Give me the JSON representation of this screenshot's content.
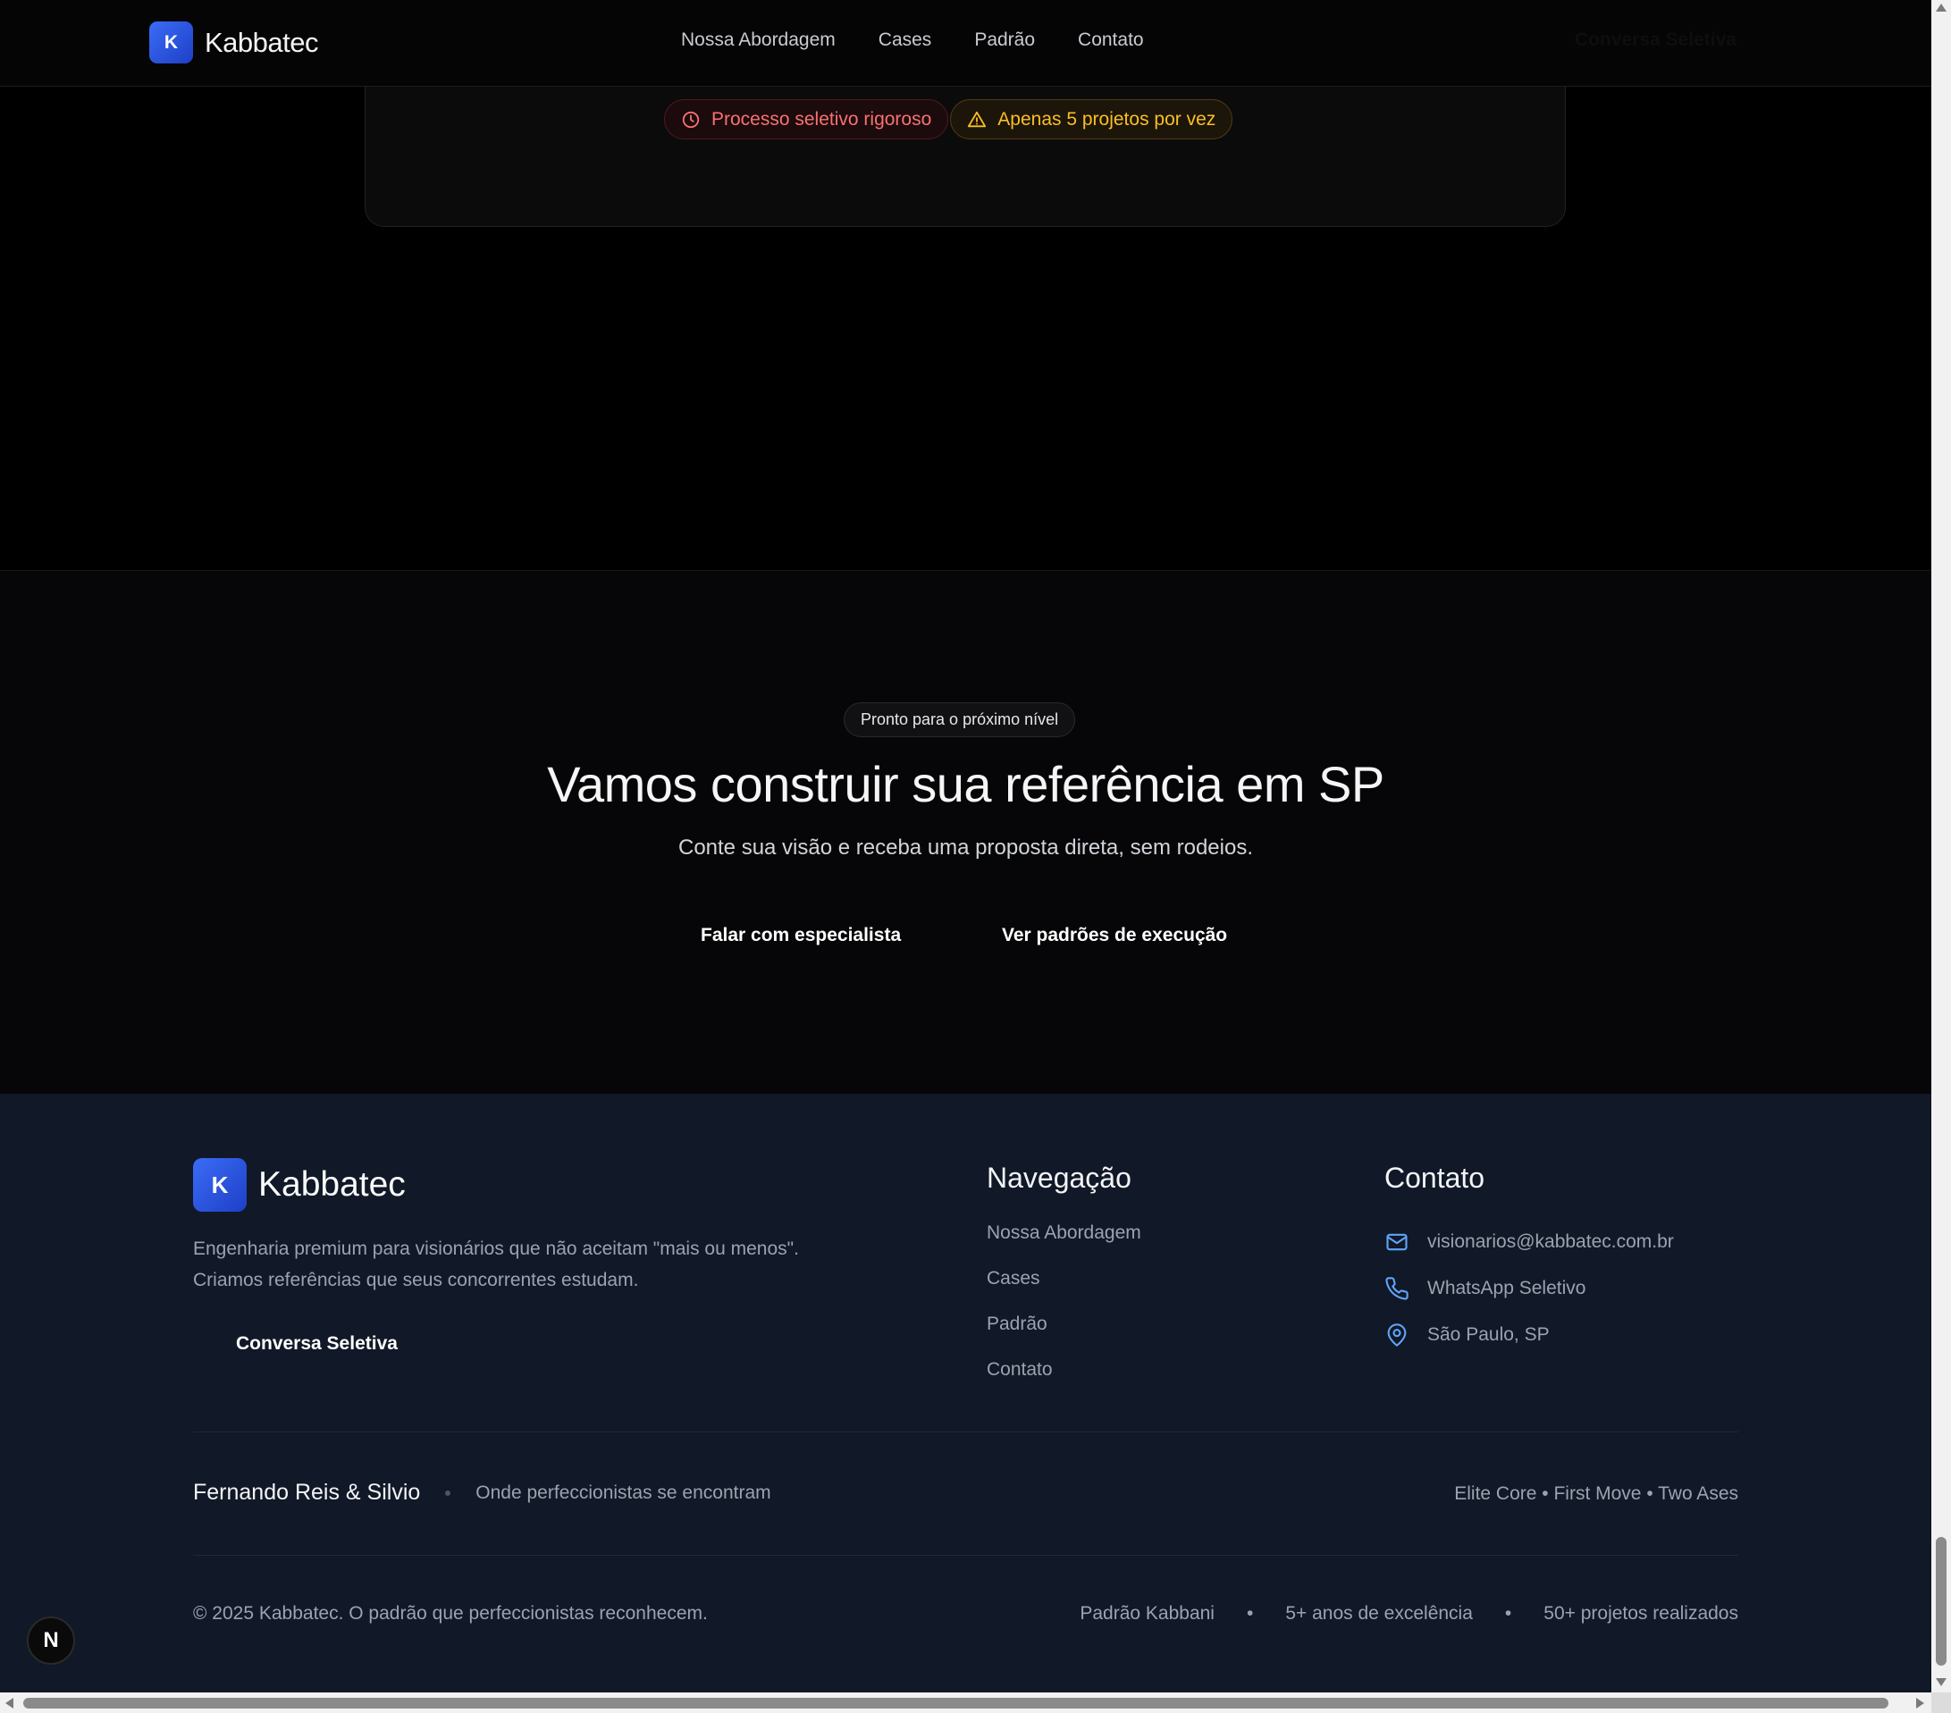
{
  "header": {
    "logo_letter": "K",
    "brand": "Kabbatec",
    "nav": [
      "Nossa Abordagem",
      "Cases",
      "Padrão",
      "Contato"
    ],
    "cta": "Conversa Seletiva"
  },
  "card": {
    "badge_red": "Processo seletivo rigoroso",
    "badge_amber": "Apenas 5 projetos por vez"
  },
  "cta_section": {
    "pill": "Pronto para o próximo nível",
    "title": "Vamos construir sua referência em SP",
    "subtitle": "Conte sua visão e receba uma proposta direta, sem rodeios.",
    "primary_button": "Falar com especialista",
    "secondary_button": "Ver padrões de execução"
  },
  "footer": {
    "logo_letter": "K",
    "brand": "Kabbatec",
    "description": "Engenharia premium para visionários que não aceitam \"mais ou menos\". Criamos referências que seus concorrentes estudam.",
    "cta": "Conversa Seletiva",
    "nav_title": "Navegação",
    "nav_items": [
      "Nossa Abordagem",
      "Cases",
      "Padrão",
      "Contato"
    ],
    "contact_title": "Contato",
    "contact": {
      "email": "visionarios@kabbatec.com.br",
      "whatsapp": "WhatsApp Seletivo",
      "location": "São Paulo, SP"
    },
    "founders": "Fernando Reis & Silvio",
    "tagline": "Onde perfeccionistas se encontram",
    "brands": "Elite Core • First Move • Two Ases",
    "copyright": "© 2025 Kabbatec. O padrão que perfeccionistas reconhecem.",
    "stats": [
      "Padrão Kabbani",
      "5+ anos de excelência",
      "50+ projetos realizados"
    ],
    "stats_separator": "•"
  },
  "floating_badge": "N",
  "colors": {
    "accent_blue": "#3b6cf6",
    "badge_red": "#f87171",
    "badge_amber": "#fbbf24",
    "footer_bg": "#111827",
    "icon_blue": "#60a5fa"
  }
}
